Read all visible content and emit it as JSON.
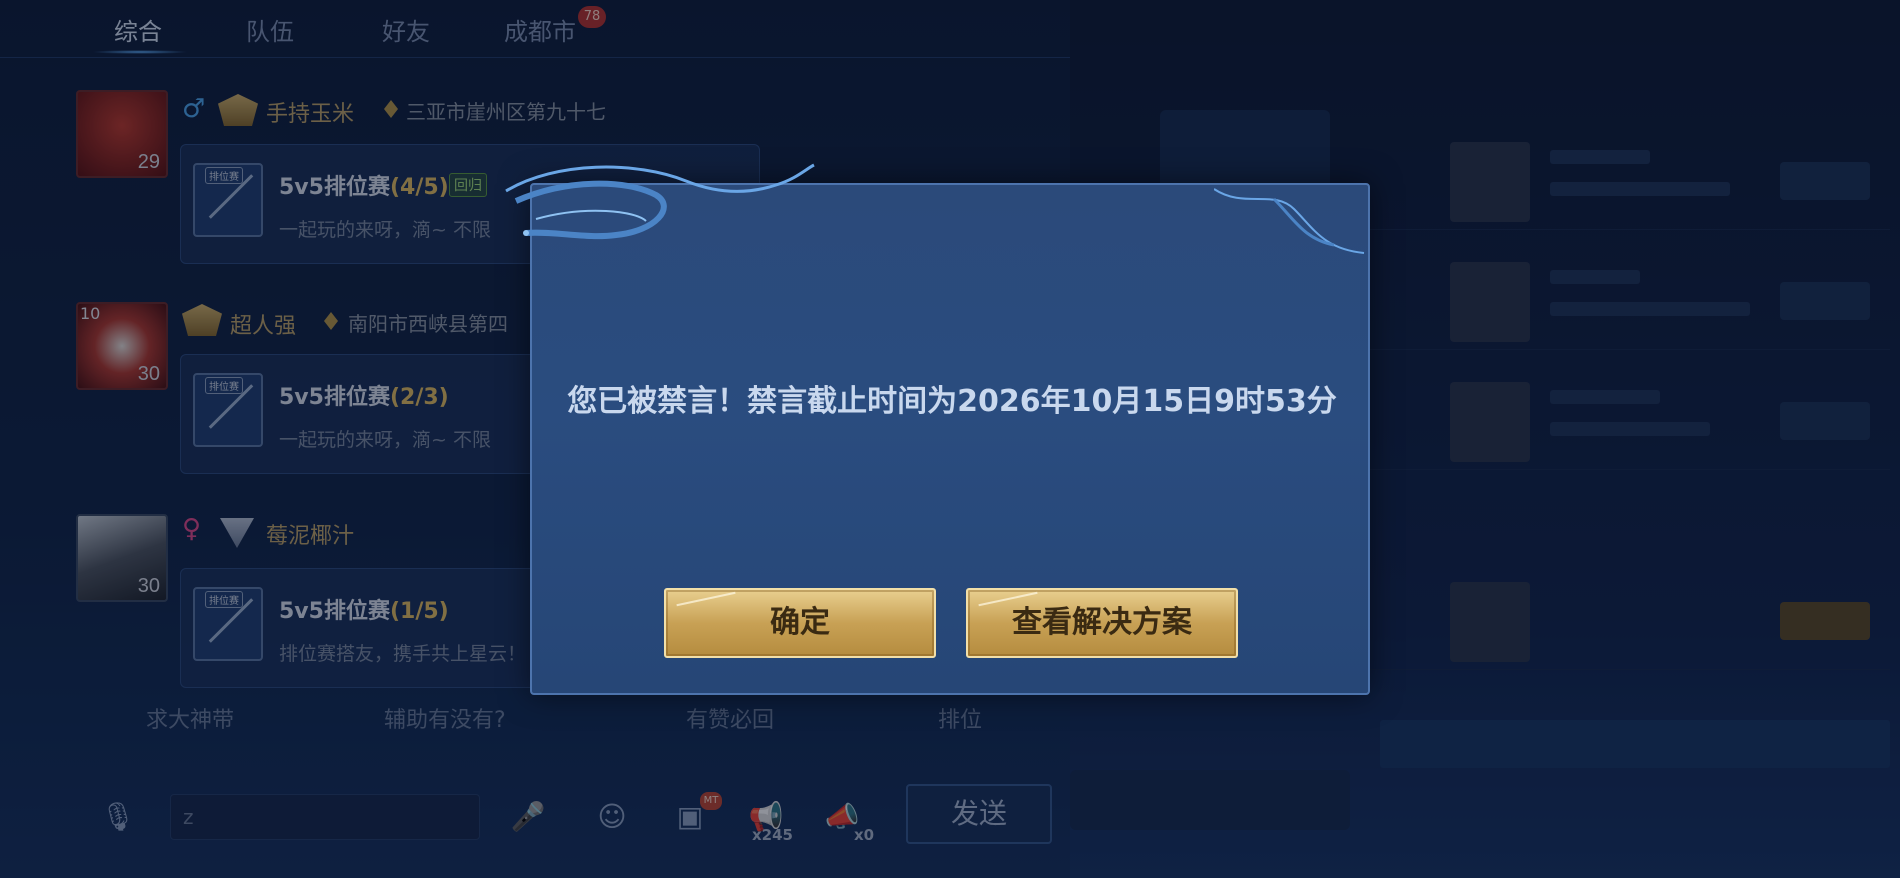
{
  "tabs": [
    {
      "label": "综合",
      "active": true
    },
    {
      "label": "队伍",
      "active": false
    },
    {
      "label": "好友",
      "active": false
    },
    {
      "label": "成都市",
      "active": false
    }
  ],
  "tab_badge": "78",
  "messages": [
    {
      "level": "29",
      "gender": "male",
      "nickname": "手持玉米",
      "location": "三亚市崖州区第九十七",
      "card_title": "5v5排位赛",
      "card_count": "(4/5)",
      "card_tag": "回归",
      "card_desc": "一起玩的来呀，滴~ 不限"
    },
    {
      "level": "30",
      "rank_badge": "10",
      "gender": "male",
      "nickname": "超人强",
      "location": "南阳市西峡县第四",
      "card_title": "5v5排位赛",
      "card_count": "(2/3)",
      "card_tag": "",
      "card_desc": "一起玩的来呀，滴~ 不限"
    },
    {
      "level": "30",
      "gender": "female",
      "nickname": "莓泥椰汁",
      "location": "",
      "card_title": "5v5排位赛",
      "card_count": "(1/5)",
      "card_tag": "",
      "card_desc": "排位赛搭友，携手共上星云！"
    }
  ],
  "thumb_label": "排位赛",
  "quick_replies": [
    "求大神带",
    "辅助有没有?",
    "有赞必回",
    "排位"
  ],
  "input": {
    "value": "z"
  },
  "input_bar": {
    "horn_count": "x245",
    "horn2_count": "x0",
    "badge": "MT",
    "send_label": "发送"
  },
  "dialog": {
    "message": "您已被禁言！禁言截止时间为2026年10月15日9时53分",
    "confirm_label": "确定",
    "solution_label": "查看解决方案"
  },
  "colors": {
    "dialog_bg": "#2b4a7a",
    "gold_button": "#c8a155",
    "nickname_gold": "#c0a468",
    "count_gold": "#e6c062"
  }
}
